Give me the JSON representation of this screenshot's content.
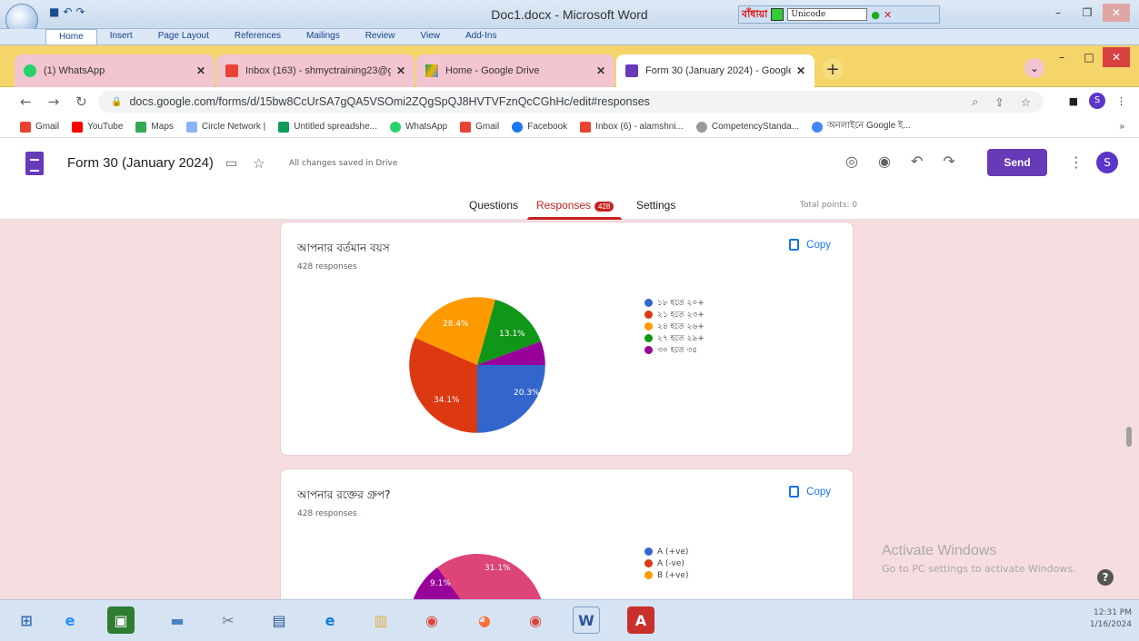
{
  "word": {
    "title": "Doc1.docx - Microsoft Word",
    "ribbon_tabs": [
      "Home",
      "Insert",
      "Page Layout",
      "References",
      "Mailings",
      "Review",
      "View",
      "Add-Ins"
    ],
    "bijoy_label": "বাঁধায়া",
    "unicode_label": "Unicode"
  },
  "browser": {
    "tabs": [
      {
        "label": "(1) WhatsApp"
      },
      {
        "label": "Inbox (163) - shmyctraining23@g"
      },
      {
        "label": "Home - Google Drive"
      },
      {
        "label": "Form 30 (January 2024) - Google"
      }
    ],
    "url": "docs.google.com/forms/d/15bw8CcUrSA7gQA5VSOmi2ZQgSpQJ8HVTVFznQcCGhHc/edit#responses",
    "bookmarks": [
      "Gmail",
      "YouTube",
      "Maps",
      "Circle Network |",
      "Untitled spreadshe...",
      "WhatsApp",
      "Gmail",
      "Facebook",
      "Inbox (6) - alamshni...",
      "CompetencyStanda...",
      "অনলাইনে Google ই..."
    ],
    "avatar_letter": "S"
  },
  "form": {
    "title": "Form 30 (January 2024)",
    "saved_text": "All changes saved in Drive",
    "send_label": "Send",
    "avatar_letter": "S",
    "tabs": {
      "questions": "Questions",
      "responses": "Responses",
      "responses_count": "428",
      "settings": "Settings"
    },
    "total_points": "Total points: 0"
  },
  "cards": [
    {
      "title": "আপনার বর্তমান বয়স",
      "responses": "428 responses",
      "copy_label": "Copy",
      "legend": [
        "১৮ হতে ২০+",
        "২১ হতে ২৩+",
        "২৪ হতে ২৬+",
        "২৭ হতে ২৯+",
        "৩০ হতে ৩৫"
      ],
      "slice_labels": [
        "20.3%",
        "34.1%",
        "28.4%",
        "13.1%"
      ]
    },
    {
      "title": "আপনার রক্তের গ্রুপ?",
      "responses": "428 responses",
      "copy_label": "Copy",
      "legend": [
        "A (+ve)",
        "A (-ve)",
        "B (+ve)"
      ],
      "slice_labels": [
        "31.1%",
        "9.1%"
      ]
    }
  ],
  "windows": {
    "activate_title": "Activate Windows",
    "activate_sub": "Go to PC settings to activate Windows."
  },
  "taskbar": {
    "time": "12:31 PM",
    "date": "1/16/2024"
  },
  "colors": {
    "blue": "#3366cc",
    "red": "#dc3912",
    "orange": "#ff9900",
    "green": "#109618",
    "purple": "#990099",
    "pink": "#dd4477",
    "accent": "#673ab7"
  }
}
